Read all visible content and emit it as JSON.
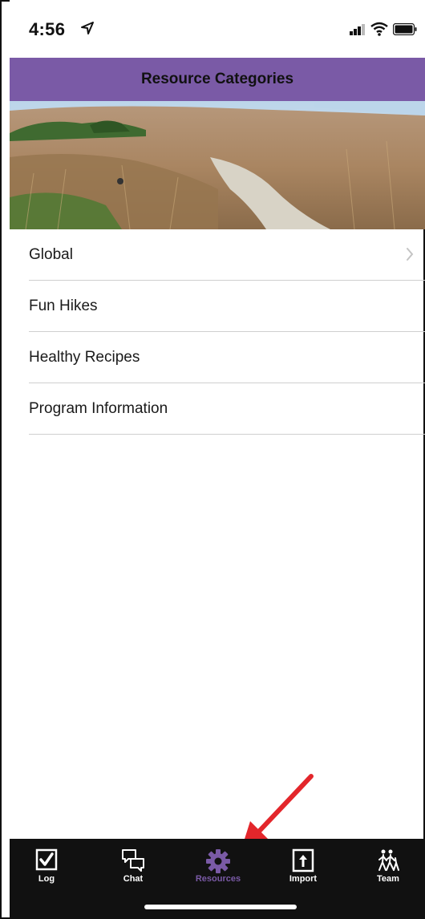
{
  "status_bar": {
    "time": "4:56",
    "icons": [
      "location-arrow-icon",
      "cellular-signal-icon",
      "wifi-icon",
      "battery-icon"
    ]
  },
  "header": {
    "title": "Resource Categories"
  },
  "hero": {
    "image": "prairie-trail-photo"
  },
  "list": {
    "items": [
      {
        "label": "Global",
        "chevron": true
      },
      {
        "label": "Fun Hikes"
      },
      {
        "label": "Healthy Recipes"
      },
      {
        "label": "Program Information"
      }
    ]
  },
  "tabbar": {
    "tabs": [
      {
        "label": "Log",
        "icon": "checkbox-icon"
      },
      {
        "label": "Chat",
        "icon": "chat-bubbles-icon"
      },
      {
        "label": "Resources",
        "icon": "gear-icon",
        "active": true
      },
      {
        "label": "Import",
        "icon": "upload-icon"
      },
      {
        "label": "Team",
        "icon": "team-walkers-icon"
      }
    ]
  },
  "colors": {
    "accent": "#7a5aa6",
    "tabbar_bg": "#111111",
    "annotation_arrow": "#e3262b"
  }
}
